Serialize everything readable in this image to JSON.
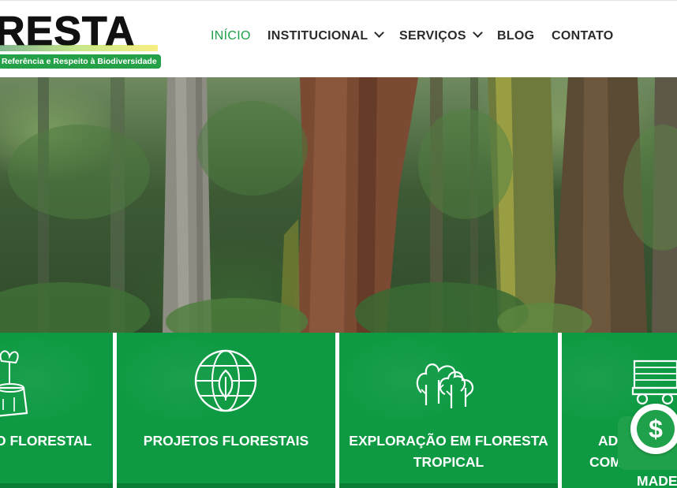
{
  "logo": {
    "wordmark": "RESTA",
    "tagline": "Referência e Respeito à Biodiversidade"
  },
  "nav": {
    "items": [
      {
        "label": "INÍCIO",
        "active": true,
        "has_dropdown": false
      },
      {
        "label": "INSTITUCIONAL",
        "active": false,
        "has_dropdown": true
      },
      {
        "label": "SERVIÇOS",
        "active": false,
        "has_dropdown": true
      },
      {
        "label": "BLOG",
        "active": false,
        "has_dropdown": false
      },
      {
        "label": "CONTATO",
        "active": false,
        "has_dropdown": false
      }
    ]
  },
  "hero": {
    "image": "forest-photo"
  },
  "services": [
    {
      "label": "O FLORESTAL",
      "icon": "tree-stump-icon"
    },
    {
      "label": "PROJETOS FLORESTAIS",
      "icon": "globe-leaf-icon"
    },
    {
      "label": "EXPLORAÇÃO EM FLORESTA TROPICAL",
      "icon": "trees-forest-icon"
    },
    {
      "label": "AD COM MADE",
      "line1": "AD",
      "line2": "COM",
      "line3": "MADE",
      "icon": "log-truck-icon"
    }
  ],
  "chat_button": {
    "icon": "dollar-chat-icon",
    "symbol": "$"
  },
  "colors": {
    "brand_green": "#1fa04a",
    "panel_green": "#0e9a43",
    "nav_text": "#2a2a2a"
  }
}
